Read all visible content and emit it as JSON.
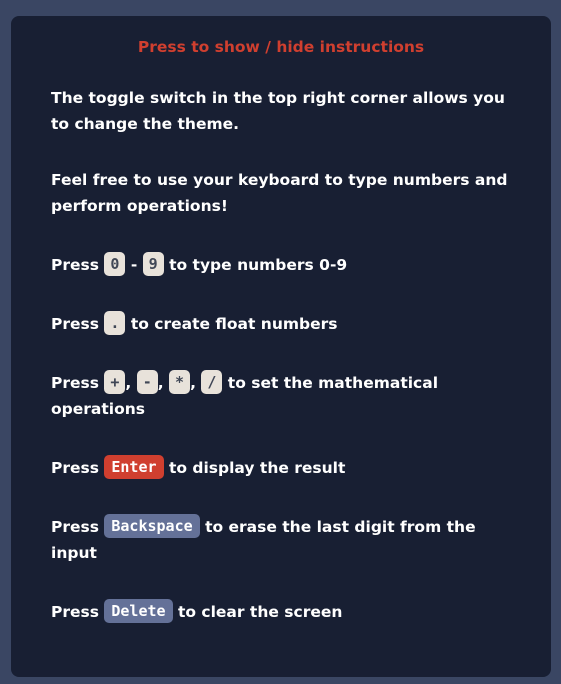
{
  "instructions": {
    "toggle_label": "Press to show / hide instructions",
    "theme_text": "The toggle switch in the top right corner allows you to change the theme.",
    "keyboard_text": "Feel free to use your keyboard to type numbers and perform operations!",
    "press": "Press",
    "numbers": {
      "key_from": "0",
      "dash": "-",
      "key_to": "9",
      "text": "to type numbers 0-9"
    },
    "float": {
      "key": ".",
      "text": "to create float numbers"
    },
    "operations": {
      "keys": [
        "+",
        "-",
        "*",
        "/"
      ],
      "sep": ",",
      "text": "to set the mathematical operations"
    },
    "enter": {
      "key": "Enter",
      "text": "to display the result"
    },
    "backspace": {
      "key": "Backspace",
      "text": "to erase the last digit from the input"
    },
    "delete": {
      "key": "Delete",
      "text": "to clear the screen"
    }
  },
  "colors": {
    "page_background": "#3a4663",
    "panel_background": "#181f33",
    "accent_red": "#d03f2f",
    "key_light": "#e8e2da",
    "key_blue": "#647198"
  }
}
